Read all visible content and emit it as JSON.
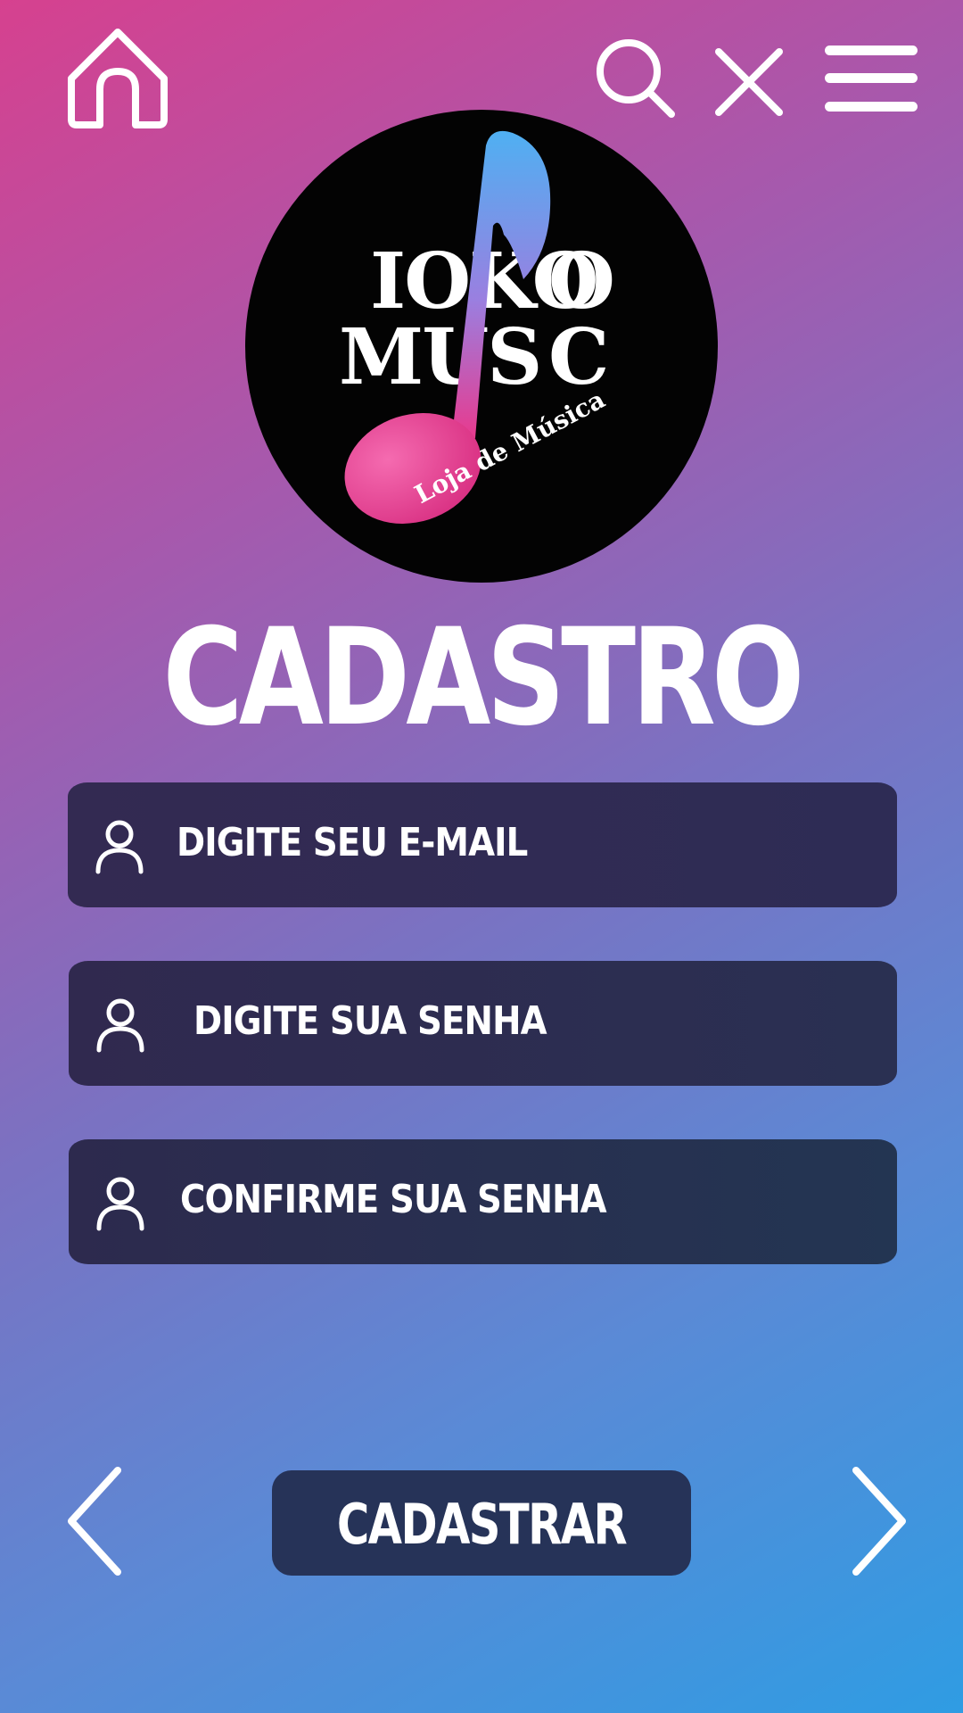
{
  "header": {
    "icons": [
      "home-icon",
      "search-icon",
      "close-icon",
      "menu-icon"
    ]
  },
  "logo": {
    "line1": "IOKO",
    "line1_tail": "O",
    "line2": "MUS",
    "line2_tail": "C",
    "tagline": "Loja de Música"
  },
  "page_title": "CADASTRO",
  "fields": [
    {
      "label": "DIGITE SEU E-MAIL",
      "icon": "user-icon"
    },
    {
      "label": "DIGITE SUA SENHA",
      "icon": "user-icon"
    },
    {
      "label": "CONFIRME SUA SENHA",
      "icon": "user-icon"
    }
  ],
  "actions": {
    "submit_label": "CADASTRAR",
    "prev_icon": "chevron-left-icon",
    "next_icon": "chevron-right-icon"
  },
  "colors": {
    "gradient_top_left": "#d6418f",
    "gradient_bottom_right": "#2f9ce3",
    "field_fill": "#2e2a4f",
    "button_fill": "#263358",
    "note_pink": "#e83a8e",
    "note_blue": "#57a9f0"
  }
}
